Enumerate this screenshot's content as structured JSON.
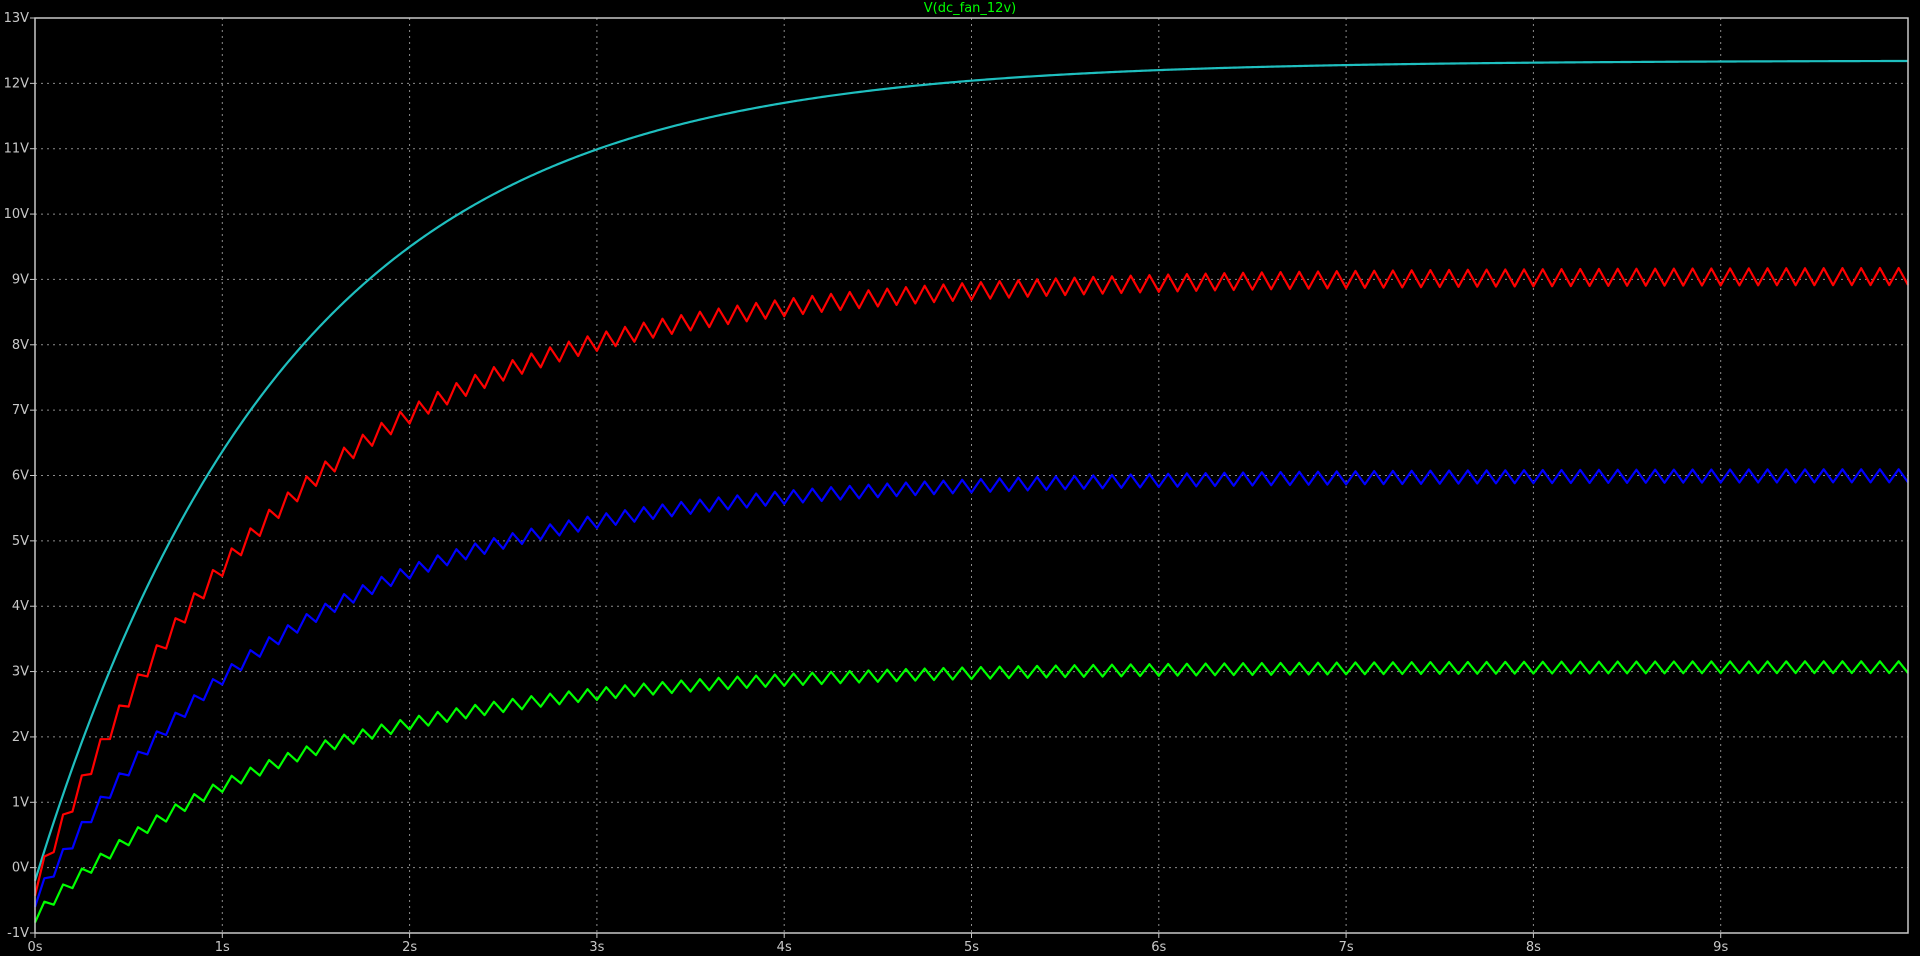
{
  "app": {
    "background": "#000000",
    "grid_color": "#8c8c8c",
    "frame_color": "#c8c8c8",
    "tick_color": "#c8c8c8"
  },
  "chart_data": {
    "type": "line",
    "title": "V(dc_fan_12v)",
    "title_color": "#00ff00",
    "xlabel": "",
    "ylabel": "",
    "xlim": [
      0,
      10
    ],
    "ylim": [
      -1,
      13
    ],
    "x_unit": "s",
    "y_unit": "V",
    "x_ticks": [
      "0s",
      "1s",
      "2s",
      "3s",
      "4s",
      "5s",
      "6s",
      "7s",
      "8s",
      "9s"
    ],
    "y_ticks": [
      "-1V",
      "0V",
      "1V",
      "2V",
      "3V",
      "4V",
      "5V",
      "6V",
      "7V",
      "8V",
      "9V",
      "10V",
      "11V",
      "12V",
      "13V"
    ],
    "grid": true,
    "grid_style": "dotted",
    "series": [
      {
        "color": "#1fbfbf",
        "kind": "smooth",
        "start_value": -0.2,
        "final_value": 12.35,
        "time_constant": 1.35,
        "ripple_amplitude": 0.0,
        "ripple_period": 0.1
      },
      {
        "color": "#ff0000",
        "kind": "sawtooth",
        "start_value": -0.3,
        "final_value": 9.05,
        "time_constant": 1.35,
        "ripple_amplitude": 0.13,
        "ripple_period": 0.1
      },
      {
        "color": "#0000ff",
        "kind": "sawtooth",
        "start_value": -0.5,
        "final_value": 6.0,
        "time_constant": 1.35,
        "ripple_amplitude": 0.1,
        "ripple_period": 0.1
      },
      {
        "color": "#00ff00",
        "kind": "sawtooth",
        "start_value": -0.75,
        "final_value": 3.07,
        "time_constant": 1.35,
        "ripple_amplitude": 0.09,
        "ripple_period": 0.1
      }
    ]
  }
}
